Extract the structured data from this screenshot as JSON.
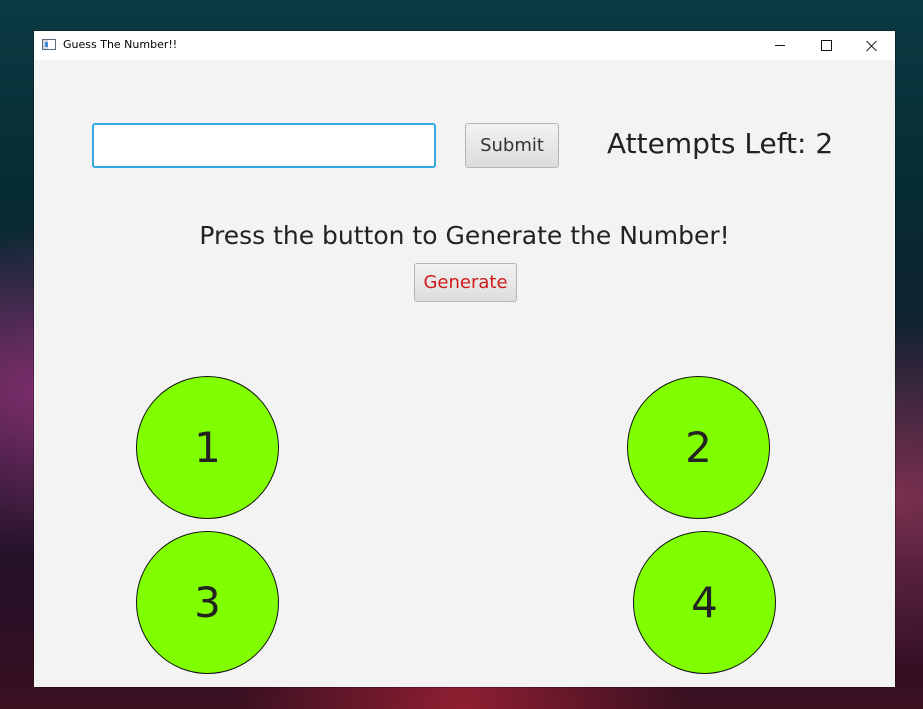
{
  "window": {
    "title": "Guess The Number!!",
    "icon": "java-app-icon"
  },
  "controls": {
    "minimize_icon": "minimize-icon",
    "maximize_icon": "maximize-icon",
    "close_icon": "close-icon"
  },
  "form": {
    "guess_value": "",
    "guess_placeholder": "",
    "submit_label": "Submit",
    "attempts_text": "Attempts Left: 2"
  },
  "generator": {
    "prompt": "Press the button to Generate the Number!",
    "generate_label": "Generate",
    "generate_color": "#d11a1a"
  },
  "choices": {
    "color": "#80ff00",
    "items": [
      {
        "label": "1"
      },
      {
        "label": "2"
      },
      {
        "label": "3"
      },
      {
        "label": "4"
      }
    ]
  }
}
